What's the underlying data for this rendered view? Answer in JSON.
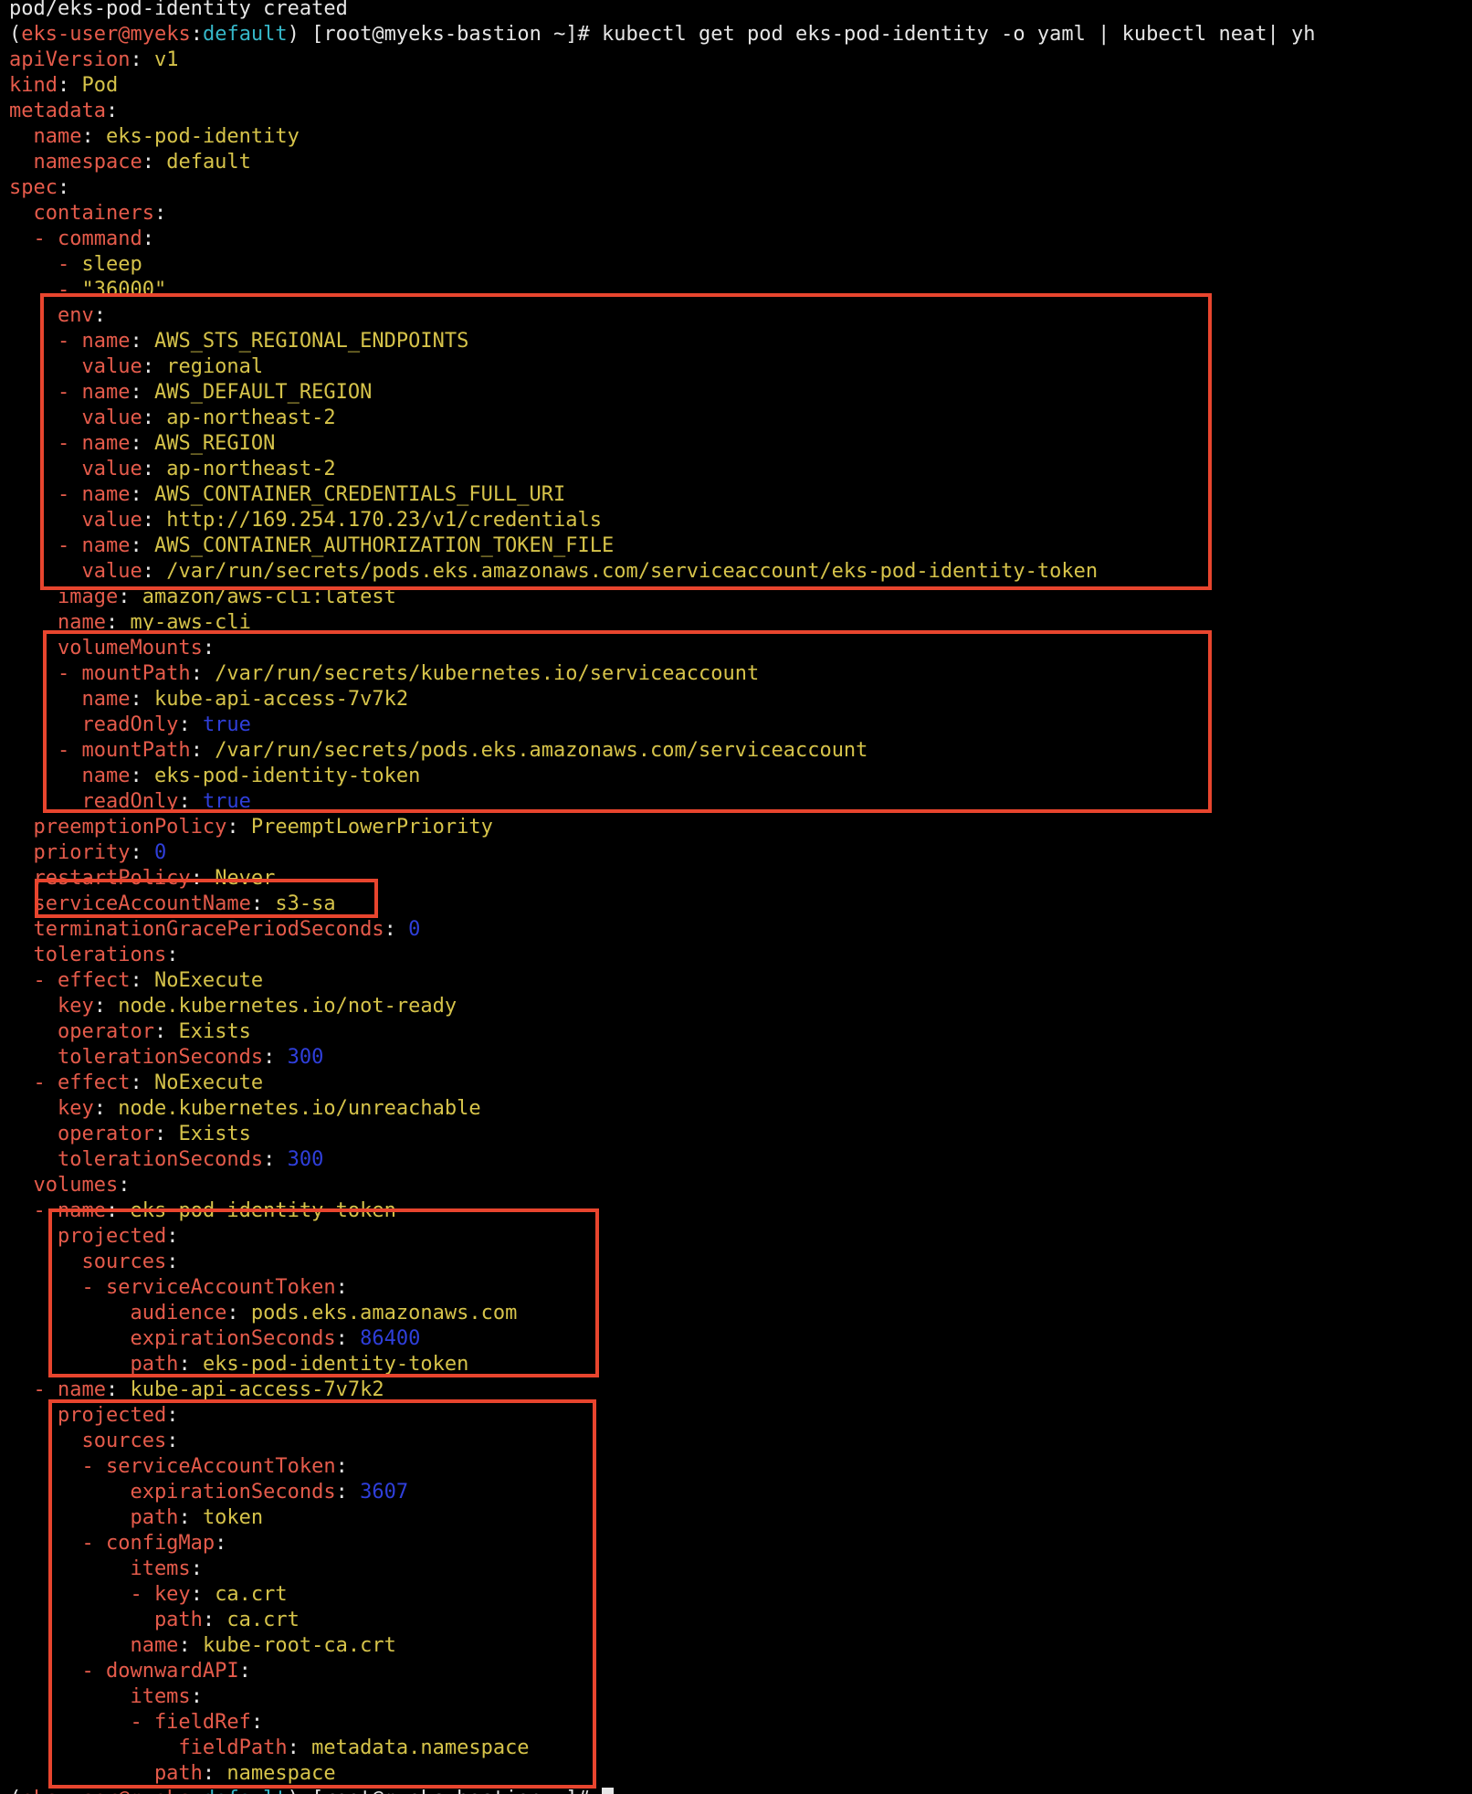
{
  "prompt_top": {
    "user": "eks-user",
    "at": "@",
    "host": "myeks",
    "colon": ":",
    "ns": "default",
    "rest": ") [root@myeks-bastion ~]# ",
    "command": "kubectl get pod eks-pod-identity -o yaml | kubectl neat| yh"
  },
  "prompt_bottom": {
    "user": "eks-user",
    "at": "@",
    "host": "myeks",
    "colon": ":",
    "ns": "default",
    "rest": ") [root@myeks-bastion ~]# "
  },
  "lines": [
    {
      "segs": [
        {
          "t": "pod/eks-pod-identity created",
          "c": "pt"
        }
      ]
    },
    {
      "prompt": "top"
    },
    {
      "segs": [
        {
          "t": "apiVersion",
          "c": "k"
        },
        {
          "t": ": ",
          "c": "pt"
        },
        {
          "t": "v1",
          "c": "v"
        }
      ]
    },
    {
      "segs": [
        {
          "t": "kind",
          "c": "k"
        },
        {
          "t": ": ",
          "c": "pt"
        },
        {
          "t": "Pod",
          "c": "v"
        }
      ]
    },
    {
      "segs": [
        {
          "t": "metadata",
          "c": "k"
        },
        {
          "t": ":",
          "c": "pt"
        }
      ]
    },
    {
      "segs": [
        {
          "t": "  name",
          "c": "k"
        },
        {
          "t": ": ",
          "c": "pt"
        },
        {
          "t": "eks-pod-identity",
          "c": "v"
        }
      ]
    },
    {
      "segs": [
        {
          "t": "  namespace",
          "c": "k"
        },
        {
          "t": ": ",
          "c": "pt"
        },
        {
          "t": "default",
          "c": "v"
        }
      ]
    },
    {
      "segs": [
        {
          "t": "spec",
          "c": "k"
        },
        {
          "t": ":",
          "c": "pt"
        }
      ]
    },
    {
      "segs": [
        {
          "t": "  containers",
          "c": "k"
        },
        {
          "t": ":",
          "c": "pt"
        }
      ]
    },
    {
      "segs": [
        {
          "t": "  - command",
          "c": "k"
        },
        {
          "t": ":",
          "c": "pt"
        }
      ]
    },
    {
      "segs": [
        {
          "t": "    - ",
          "c": "k"
        },
        {
          "t": "sleep",
          "c": "v"
        }
      ]
    },
    {
      "segs": [
        {
          "t": "    - ",
          "c": "k"
        },
        {
          "t": "\"36000\"",
          "c": "v"
        }
      ]
    },
    {
      "segs": [
        {
          "t": "    env",
          "c": "k"
        },
        {
          "t": ":",
          "c": "pt"
        }
      ]
    },
    {
      "segs": [
        {
          "t": "    - name",
          "c": "k"
        },
        {
          "t": ": ",
          "c": "pt"
        },
        {
          "t": "AWS_STS_REGIONAL_ENDPOINTS",
          "c": "v"
        }
      ]
    },
    {
      "segs": [
        {
          "t": "      value",
          "c": "k"
        },
        {
          "t": ": ",
          "c": "pt"
        },
        {
          "t": "regional",
          "c": "v"
        }
      ]
    },
    {
      "segs": [
        {
          "t": "    - name",
          "c": "k"
        },
        {
          "t": ": ",
          "c": "pt"
        },
        {
          "t": "AWS_DEFAULT_REGION",
          "c": "v"
        }
      ]
    },
    {
      "segs": [
        {
          "t": "      value",
          "c": "k"
        },
        {
          "t": ": ",
          "c": "pt"
        },
        {
          "t": "ap-northeast-2",
          "c": "v"
        }
      ]
    },
    {
      "segs": [
        {
          "t": "    - name",
          "c": "k"
        },
        {
          "t": ": ",
          "c": "pt"
        },
        {
          "t": "AWS_REGION",
          "c": "v"
        }
      ]
    },
    {
      "segs": [
        {
          "t": "      value",
          "c": "k"
        },
        {
          "t": ": ",
          "c": "pt"
        },
        {
          "t": "ap-northeast-2",
          "c": "v"
        }
      ]
    },
    {
      "segs": [
        {
          "t": "    - name",
          "c": "k"
        },
        {
          "t": ": ",
          "c": "pt"
        },
        {
          "t": "AWS_CONTAINER_CREDENTIALS_FULL_URI",
          "c": "v"
        }
      ]
    },
    {
      "segs": [
        {
          "t": "      value",
          "c": "k"
        },
        {
          "t": ": ",
          "c": "pt"
        },
        {
          "t": "http://169.254.170.23/v1/credentials",
          "c": "v"
        }
      ]
    },
    {
      "segs": [
        {
          "t": "    - name",
          "c": "k"
        },
        {
          "t": ": ",
          "c": "pt"
        },
        {
          "t": "AWS_CONTAINER_AUTHORIZATION_TOKEN_FILE",
          "c": "v"
        }
      ]
    },
    {
      "segs": [
        {
          "t": "      value",
          "c": "k"
        },
        {
          "t": ": ",
          "c": "pt"
        },
        {
          "t": "/var/run/secrets/pods.eks.amazonaws.com/serviceaccount/eks-pod-identity-token",
          "c": "v"
        }
      ]
    },
    {
      "segs": [
        {
          "t": "    image",
          "c": "k"
        },
        {
          "t": ": ",
          "c": "pt"
        },
        {
          "t": "amazon/aws-cli:latest",
          "c": "v"
        }
      ]
    },
    {
      "segs": [
        {
          "t": "    name",
          "c": "k"
        },
        {
          "t": ": ",
          "c": "pt"
        },
        {
          "t": "my-aws-cli",
          "c": "v"
        }
      ]
    },
    {
      "segs": [
        {
          "t": "    volumeMounts",
          "c": "k"
        },
        {
          "t": ":",
          "c": "pt"
        }
      ]
    },
    {
      "segs": [
        {
          "t": "    - mountPath",
          "c": "k"
        },
        {
          "t": ": ",
          "c": "pt"
        },
        {
          "t": "/var/run/secrets/kubernetes.io/serviceaccount",
          "c": "v"
        }
      ]
    },
    {
      "segs": [
        {
          "t": "      name",
          "c": "k"
        },
        {
          "t": ": ",
          "c": "pt"
        },
        {
          "t": "kube-api-access-7v7k2",
          "c": "v"
        }
      ]
    },
    {
      "segs": [
        {
          "t": "      readOnly",
          "c": "k"
        },
        {
          "t": ": ",
          "c": "pt"
        },
        {
          "t": "true",
          "c": "n"
        }
      ]
    },
    {
      "segs": [
        {
          "t": "    - mountPath",
          "c": "k"
        },
        {
          "t": ": ",
          "c": "pt"
        },
        {
          "t": "/var/run/secrets/pods.eks.amazonaws.com/serviceaccount",
          "c": "v"
        }
      ]
    },
    {
      "segs": [
        {
          "t": "      name",
          "c": "k"
        },
        {
          "t": ": ",
          "c": "pt"
        },
        {
          "t": "eks-pod-identity-token",
          "c": "v"
        }
      ]
    },
    {
      "segs": [
        {
          "t": "      readOnly",
          "c": "k"
        },
        {
          "t": ": ",
          "c": "pt"
        },
        {
          "t": "true",
          "c": "n"
        }
      ]
    },
    {
      "segs": [
        {
          "t": "  preemptionPolicy",
          "c": "k"
        },
        {
          "t": ": ",
          "c": "pt"
        },
        {
          "t": "PreemptLowerPriority",
          "c": "v"
        }
      ]
    },
    {
      "segs": [
        {
          "t": "  priority",
          "c": "k"
        },
        {
          "t": ": ",
          "c": "pt"
        },
        {
          "t": "0",
          "c": "n"
        }
      ]
    },
    {
      "segs": [
        {
          "t": "  restartPolicy",
          "c": "k"
        },
        {
          "t": ": ",
          "c": "pt"
        },
        {
          "t": "Never",
          "c": "v"
        }
      ]
    },
    {
      "segs": [
        {
          "t": "  serviceAccountName",
          "c": "k"
        },
        {
          "t": ": ",
          "c": "pt"
        },
        {
          "t": "s3-sa",
          "c": "v"
        }
      ]
    },
    {
      "segs": [
        {
          "t": "  terminationGracePeriodSeconds",
          "c": "k"
        },
        {
          "t": ": ",
          "c": "pt"
        },
        {
          "t": "0",
          "c": "n"
        }
      ]
    },
    {
      "segs": [
        {
          "t": "  tolerations",
          "c": "k"
        },
        {
          "t": ":",
          "c": "pt"
        }
      ]
    },
    {
      "segs": [
        {
          "t": "  - effect",
          "c": "k"
        },
        {
          "t": ": ",
          "c": "pt"
        },
        {
          "t": "NoExecute",
          "c": "v"
        }
      ]
    },
    {
      "segs": [
        {
          "t": "    key",
          "c": "k"
        },
        {
          "t": ": ",
          "c": "pt"
        },
        {
          "t": "node.kubernetes.io/not-ready",
          "c": "v"
        }
      ]
    },
    {
      "segs": [
        {
          "t": "    operator",
          "c": "k"
        },
        {
          "t": ": ",
          "c": "pt"
        },
        {
          "t": "Exists",
          "c": "v"
        }
      ]
    },
    {
      "segs": [
        {
          "t": "    tolerationSeconds",
          "c": "k"
        },
        {
          "t": ": ",
          "c": "pt"
        },
        {
          "t": "300",
          "c": "n"
        }
      ]
    },
    {
      "segs": [
        {
          "t": "  - effect",
          "c": "k"
        },
        {
          "t": ": ",
          "c": "pt"
        },
        {
          "t": "NoExecute",
          "c": "v"
        }
      ]
    },
    {
      "segs": [
        {
          "t": "    key",
          "c": "k"
        },
        {
          "t": ": ",
          "c": "pt"
        },
        {
          "t": "node.kubernetes.io/unreachable",
          "c": "v"
        }
      ]
    },
    {
      "segs": [
        {
          "t": "    operator",
          "c": "k"
        },
        {
          "t": ": ",
          "c": "pt"
        },
        {
          "t": "Exists",
          "c": "v"
        }
      ]
    },
    {
      "segs": [
        {
          "t": "    tolerationSeconds",
          "c": "k"
        },
        {
          "t": ": ",
          "c": "pt"
        },
        {
          "t": "300",
          "c": "n"
        }
      ]
    },
    {
      "segs": [
        {
          "t": "  volumes",
          "c": "k"
        },
        {
          "t": ":",
          "c": "pt"
        }
      ]
    },
    {
      "segs": [
        {
          "t": "  - name",
          "c": "k"
        },
        {
          "t": ": ",
          "c": "pt"
        },
        {
          "t": "eks-pod-identity-token",
          "c": "v"
        }
      ]
    },
    {
      "segs": [
        {
          "t": "    projected",
          "c": "k"
        },
        {
          "t": ":",
          "c": "pt"
        }
      ]
    },
    {
      "segs": [
        {
          "t": "      sources",
          "c": "k"
        },
        {
          "t": ":",
          "c": "pt"
        }
      ]
    },
    {
      "segs": [
        {
          "t": "      - serviceAccountToken",
          "c": "k"
        },
        {
          "t": ":",
          "c": "pt"
        }
      ]
    },
    {
      "segs": [
        {
          "t": "          audience",
          "c": "k"
        },
        {
          "t": ": ",
          "c": "pt"
        },
        {
          "t": "pods.eks.amazonaws.com",
          "c": "v"
        }
      ]
    },
    {
      "segs": [
        {
          "t": "          expirationSeconds",
          "c": "k"
        },
        {
          "t": ": ",
          "c": "pt"
        },
        {
          "t": "86400",
          "c": "n"
        }
      ]
    },
    {
      "segs": [
        {
          "t": "          path",
          "c": "k"
        },
        {
          "t": ": ",
          "c": "pt"
        },
        {
          "t": "eks-pod-identity-token",
          "c": "v"
        }
      ]
    },
    {
      "segs": [
        {
          "t": "  - name",
          "c": "k"
        },
        {
          "t": ": ",
          "c": "pt"
        },
        {
          "t": "kube-api-access-7v7k2",
          "c": "v"
        }
      ]
    },
    {
      "segs": [
        {
          "t": "    projected",
          "c": "k"
        },
        {
          "t": ":",
          "c": "pt"
        }
      ]
    },
    {
      "segs": [
        {
          "t": "      sources",
          "c": "k"
        },
        {
          "t": ":",
          "c": "pt"
        }
      ]
    },
    {
      "segs": [
        {
          "t": "      - serviceAccountToken",
          "c": "k"
        },
        {
          "t": ":",
          "c": "pt"
        }
      ]
    },
    {
      "segs": [
        {
          "t": "          expirationSeconds",
          "c": "k"
        },
        {
          "t": ": ",
          "c": "pt"
        },
        {
          "t": "3607",
          "c": "n"
        }
      ]
    },
    {
      "segs": [
        {
          "t": "          path",
          "c": "k"
        },
        {
          "t": ": ",
          "c": "pt"
        },
        {
          "t": "token",
          "c": "v"
        }
      ]
    },
    {
      "segs": [
        {
          "t": "      - configMap",
          "c": "k"
        },
        {
          "t": ":",
          "c": "pt"
        }
      ]
    },
    {
      "segs": [
        {
          "t": "          items",
          "c": "k"
        },
        {
          "t": ":",
          "c": "pt"
        }
      ]
    },
    {
      "segs": [
        {
          "t": "          - key",
          "c": "k"
        },
        {
          "t": ": ",
          "c": "pt"
        },
        {
          "t": "ca.crt",
          "c": "v"
        }
      ]
    },
    {
      "segs": [
        {
          "t": "            path",
          "c": "k"
        },
        {
          "t": ": ",
          "c": "pt"
        },
        {
          "t": "ca.crt",
          "c": "v"
        }
      ]
    },
    {
      "segs": [
        {
          "t": "          name",
          "c": "k"
        },
        {
          "t": ": ",
          "c": "pt"
        },
        {
          "t": "kube-root-ca.crt",
          "c": "v"
        }
      ]
    },
    {
      "segs": [
        {
          "t": "      - downwardAPI",
          "c": "k"
        },
        {
          "t": ":",
          "c": "pt"
        }
      ]
    },
    {
      "segs": [
        {
          "t": "          items",
          "c": "k"
        },
        {
          "t": ":",
          "c": "pt"
        }
      ]
    },
    {
      "segs": [
        {
          "t": "          - fieldRef",
          "c": "k"
        },
        {
          "t": ":",
          "c": "pt"
        }
      ]
    },
    {
      "segs": [
        {
          "t": "              fieldPath",
          "c": "k"
        },
        {
          "t": ": ",
          "c": "pt"
        },
        {
          "t": "metadata.namespace",
          "c": "v"
        }
      ]
    },
    {
      "segs": [
        {
          "t": "            path",
          "c": "k"
        },
        {
          "t": ": ",
          "c": "pt"
        },
        {
          "t": "namespace",
          "c": "v"
        }
      ]
    },
    {
      "prompt": "bottom"
    }
  ]
}
